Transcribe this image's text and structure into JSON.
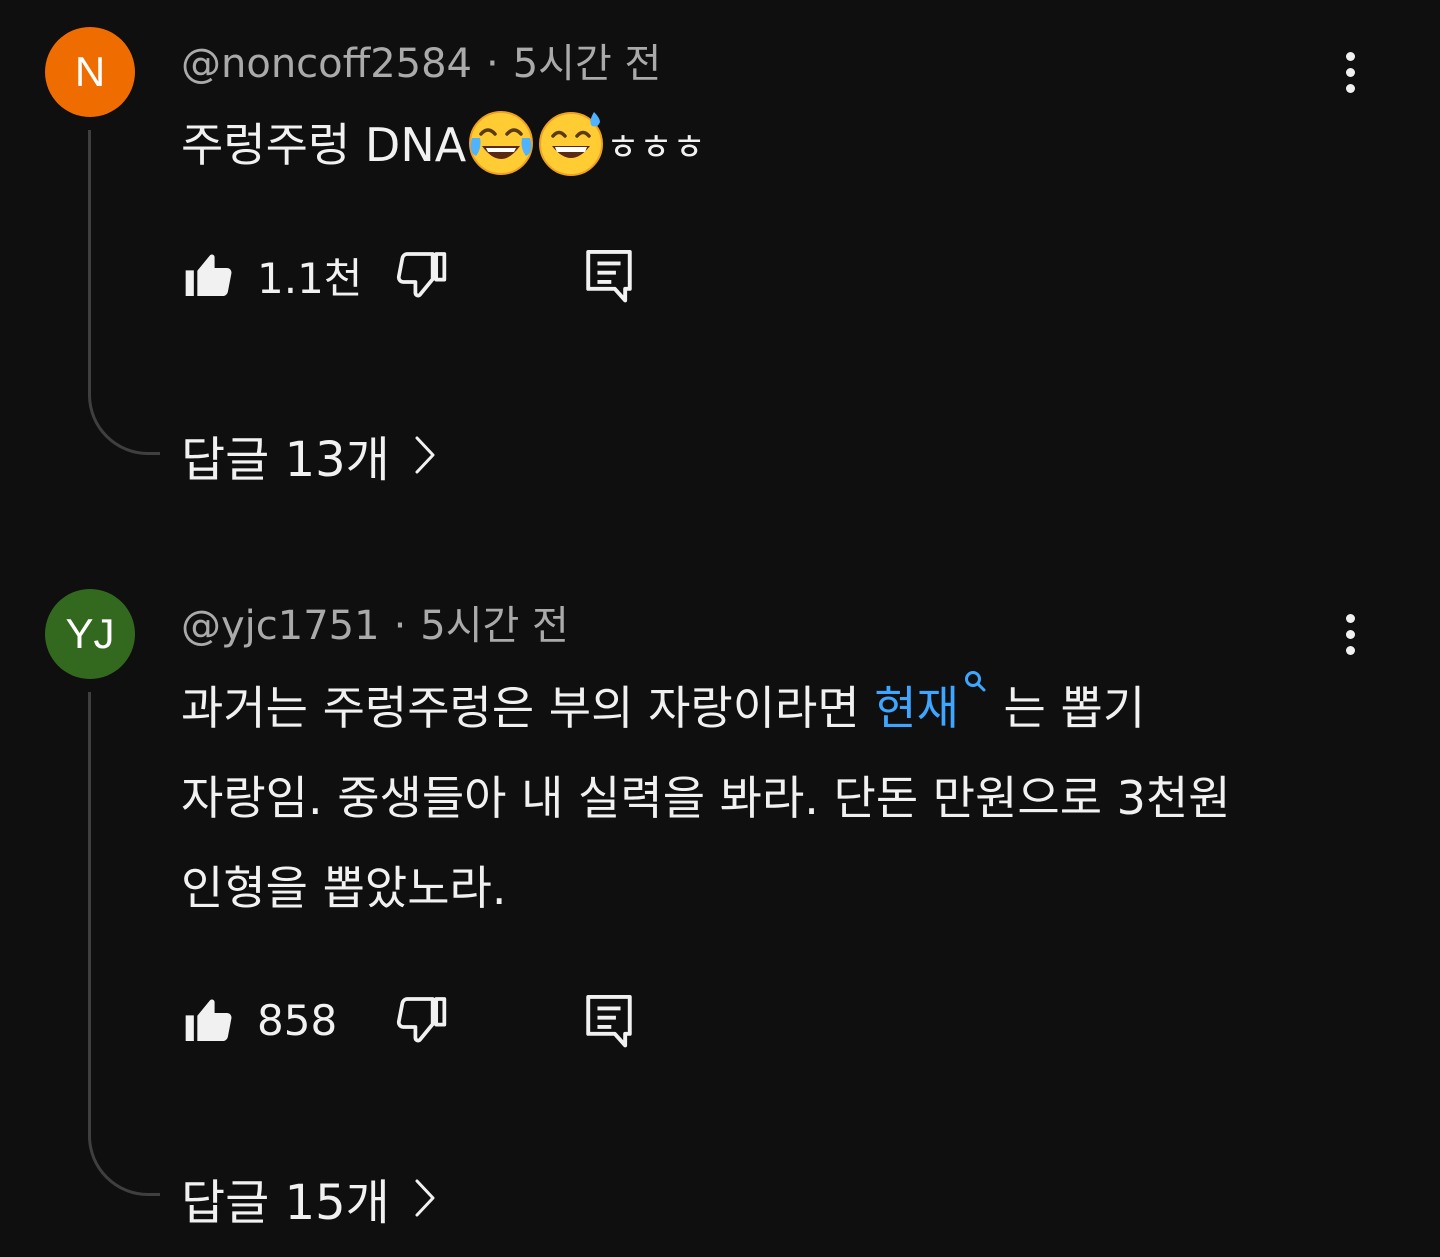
{
  "comments": [
    {
      "avatar_letter": "N",
      "avatar_color": "#ef6c00",
      "author": "@noncoff2584",
      "separator": "·",
      "time": "5시간 전",
      "text_before_emoji": "주렁주렁 DNA",
      "emojis": [
        "face-with-tears-of-joy-emoji",
        "grinning-face-with-sweat-emoji"
      ],
      "text_after_emoji": "ㅎㅎㅎ",
      "likes": "1.1천",
      "replies_label": "답글 13개"
    },
    {
      "avatar_letter": "YJ",
      "avatar_color": "#33691e",
      "author": "@yjc1751",
      "separator": "·",
      "time": "5시간 전",
      "line1_before": "과거는 주렁주렁은 부의 자랑이라면 ",
      "line1_link": "현재",
      "line1_after": " 는 뽑기",
      "line2": "자랑임. 중생들아 내 실력을 봐라. 단돈 만원으로 3천원",
      "line3": "인형을 뽑았노라.",
      "link_color": "#3ea6ff",
      "likes": "858",
      "replies_label": "답글 15개"
    }
  ]
}
